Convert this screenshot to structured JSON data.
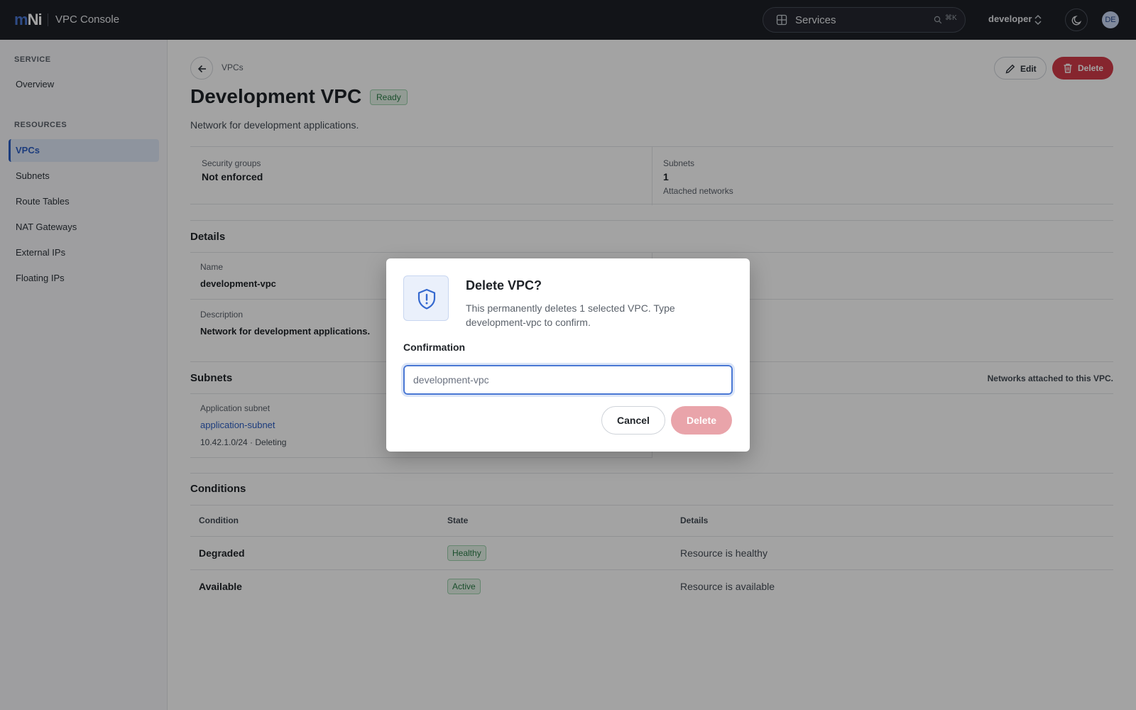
{
  "topbar": {
    "logo_m": "m",
    "logo_rest": "Ni",
    "app_title": "VPC Console",
    "search_label": "Services",
    "search_shortcut": "⌘K",
    "project": "developer",
    "avatar_initials": "DE"
  },
  "sidebar": {
    "service_heading": "SERVICE",
    "overview": "Overview",
    "resources_heading": "RESOURCES",
    "items": [
      {
        "label": "VPCs"
      },
      {
        "label": "Subnets"
      },
      {
        "label": "Route Tables"
      },
      {
        "label": "NAT Gateways"
      },
      {
        "label": "External IPs"
      },
      {
        "label": "Floating IPs"
      }
    ],
    "active_item": "VPCs"
  },
  "header": {
    "breadcrumb": "VPCs",
    "title": "Development VPC",
    "status": "Ready",
    "description": "Network for development applications.",
    "edit_label": "Edit",
    "delete_label": "Delete"
  },
  "summary": {
    "security_label": "Security groups",
    "security_value": "Not enforced",
    "subnets_label": "Subnets",
    "subnets_value": "1",
    "subnets_sub": "Attached networks"
  },
  "details": {
    "title": "Details",
    "name_label": "Name",
    "name_value": "development-vpc",
    "description_label": "Description",
    "description_value": "Network for development applications."
  },
  "subnets": {
    "title": "Subnets",
    "note": "Networks attached to this VPC.",
    "items": [
      {
        "label": "Application subnet",
        "name": "application-subnet",
        "meta": "10.42.1.0/24 · Deleting"
      }
    ]
  },
  "conditions": {
    "title": "Conditions",
    "columns": [
      "Condition",
      "State",
      "Details"
    ],
    "rows": [
      {
        "condition": "Degraded",
        "state": "Healthy",
        "details": "Resource is healthy"
      },
      {
        "condition": "Available",
        "state": "Active",
        "details": "Resource is available"
      }
    ]
  },
  "modal": {
    "title": "Delete VPC?",
    "description": "This permanently deletes 1 selected VPC. Type development-vpc to confirm.",
    "field_label": "Confirmation",
    "input_placeholder": "development-vpc",
    "input_value": "",
    "cancel_label": "Cancel",
    "confirm_label": "Delete"
  },
  "colors": {
    "topbar_bg": "#1d2027",
    "accent": "#2c5fc4",
    "danger": "#d23a48",
    "danger_disabled": "#e9a4aa",
    "success": "#2a7a45"
  },
  "icons": [
    "grid-icon",
    "search-icon",
    "chevron-updown-icon",
    "moon-icon",
    "arrow-left-icon",
    "pencil-icon",
    "trash-icon",
    "shield-alert-icon"
  ]
}
